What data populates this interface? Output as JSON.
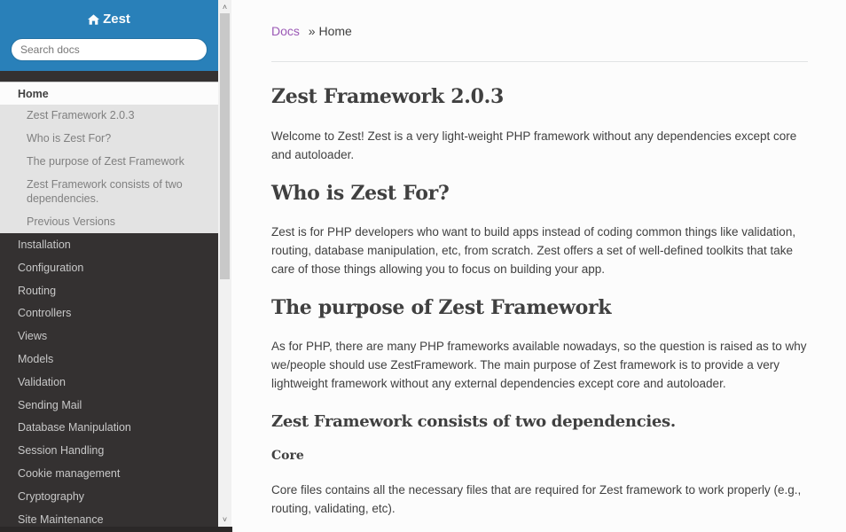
{
  "sidebar": {
    "brand": "Zest",
    "brand_icon": "home-icon",
    "search_placeholder": "Search docs",
    "current": "Home",
    "sub_items": [
      "Zest Framework 2.0.3",
      "Who is Zest For?",
      "The purpose of Zest Framework",
      "Zest Framework consists of two dependencies.",
      "Previous Versions"
    ],
    "items": [
      "Installation",
      "Configuration",
      "Routing",
      "Controllers",
      "Views",
      "Models",
      "Validation",
      "Sending Mail",
      "Database Manipulation",
      "Session Handling",
      "Cookie management",
      "Cryptography",
      "Site Maintenance"
    ]
  },
  "breadcrumb": {
    "root": "Docs",
    "separator": "»",
    "current": "Home"
  },
  "content": {
    "title": "Zest Framework 2.0.3",
    "intro": "Welcome to Zest! Zest is a very light-weight PHP framework without any dependencies except core and autoloader.",
    "sections": [
      {
        "heading": "Who is Zest For?",
        "body": "Zest is for PHP developers who want to build apps instead of coding common things like validation, routing, database manipulation, etc, from scratch. Zest offers a set of well-defined toolkits that take care of those things allowing you to focus on building your app."
      },
      {
        "heading": "The purpose of Zest Framework",
        "body": "As for PHP, there are many PHP frameworks available nowadays, so the question is raised as to why we/people should use ZestFramework. The main purpose of Zest framework is to provide a very lightweight framework without any external dependencies except core and autoloader."
      },
      {
        "heading": "Zest Framework consists of two dependencies.",
        "subheading": "Core",
        "body": "Core files contains all the necessary files that are required for Zest framework to work properly (e.g., routing, validating, etc)."
      }
    ]
  },
  "colors": {
    "header_blue": "#2980b9",
    "sidebar_dark": "#343131",
    "link_purple": "#9b59b6",
    "text": "#404040"
  }
}
